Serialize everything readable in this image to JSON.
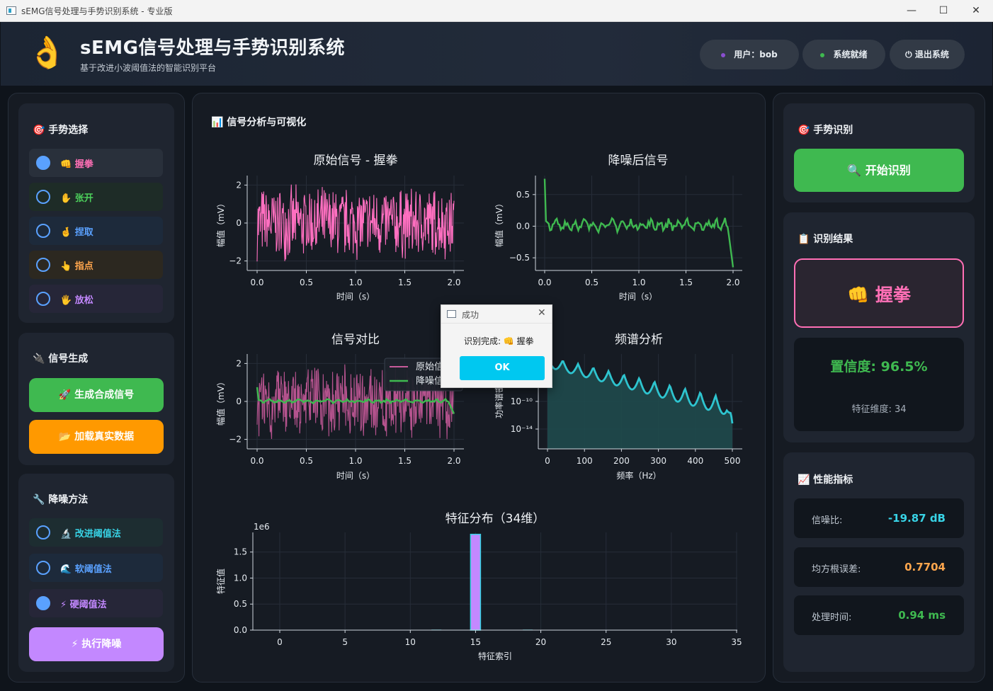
{
  "window": {
    "title": "sEMG信号处理与手势识别系统 - 专业版",
    "minimize": "—",
    "maximize": "☐",
    "close": "✕"
  },
  "header": {
    "logo": "👌",
    "title": "sEMG信号处理与手势识别系统",
    "subtitle": "基于改进小波阈值法的智能识别平台",
    "user": "用户：bob",
    "status": "系统就绪",
    "logout": "⏻ 退出系统"
  },
  "gesture_select": {
    "title": "🎯 手势选择",
    "options": [
      {
        "label": "👊 握拳",
        "selected": true,
        "color": "#ff6fb5"
      },
      {
        "label": "✋ 张开",
        "selected": false,
        "color": "#4ccf5b"
      },
      {
        "label": "🤞 捏取",
        "selected": false,
        "color": "#5aa1ff"
      },
      {
        "label": "👆 指点",
        "selected": false,
        "color": "#ffa64d"
      },
      {
        "label": "🖐 放松",
        "selected": false,
        "color": "#c388ff"
      }
    ]
  },
  "signal_gen": {
    "title": "🔌 信号生成",
    "generate": "🚀 生成合成信号",
    "load": "📂 加载真实数据"
  },
  "denoise": {
    "title": "🔧 降噪方法",
    "options": [
      {
        "label": "🔬 改进阈值法",
        "selected": false,
        "color": "#38d3e6"
      },
      {
        "label": "🌊 软阈值法",
        "selected": false,
        "color": "#5aa1ff"
      },
      {
        "label": "⚡ 硬阈值法",
        "selected": true,
        "color": "#c388ff"
      }
    ],
    "run": "⚡ 执行降噪"
  },
  "analysis": {
    "title": "📊 信号分析与可视化"
  },
  "chart_data": [
    {
      "type": "line",
      "title": "原始信号 - 握拳",
      "xlabel": "时间（s）",
      "ylabel": "幅值（mV）",
      "xlim": [
        0,
        2
      ],
      "ylim": [
        -2.5,
        2.5
      ],
      "xticks": [
        "0.0",
        "0.5",
        "1.0",
        "1.5",
        "2.0"
      ],
      "yticks": [
        "2",
        "0",
        "−2"
      ],
      "series": [
        {
          "color": "#ff6fc0",
          "amplitude": 2.1
        }
      ]
    },
    {
      "type": "line",
      "title": "降噪后信号",
      "xlabel": "时间（s）",
      "ylabel": "幅值（mV）",
      "xlim": [
        0,
        2
      ],
      "ylim": [
        -0.7,
        0.8
      ],
      "xticks": [
        "0.0",
        "0.5",
        "1.0",
        "1.5",
        "2.0"
      ],
      "yticks": [
        "0.5",
        "0.0",
        "−0.5"
      ],
      "series": [
        {
          "color": "#3fb950",
          "start": 0.75,
          "baseline": 0.0,
          "end": -0.65
        }
      ]
    },
    {
      "type": "line",
      "title": "信号对比",
      "xlabel": "时间（s）",
      "ylabel": "幅值（mV）",
      "xlim": [
        0,
        2
      ],
      "ylim": [
        -2.5,
        2.5
      ],
      "xticks": [
        "0.0",
        "0.5",
        "1.0",
        "1.5",
        "2.0"
      ],
      "yticks": [
        "2",
        "0",
        "−2"
      ],
      "legend": [
        "原始信",
        "降噪信"
      ],
      "series": [
        {
          "name": "原始信",
          "color": "#c65a9a"
        },
        {
          "name": "降噪信",
          "color": "#3fb950"
        }
      ]
    },
    {
      "type": "area",
      "title": "频谱分析",
      "xlabel": "频率（Hz）",
      "ylabel": "功率谱密",
      "xlim": [
        0,
        500
      ],
      "xticks": [
        "0",
        "100",
        "200",
        "300",
        "400",
        "500"
      ],
      "yticks": [
        "10⁻¹⁰",
        "10⁻¹⁴"
      ],
      "series": [
        {
          "color": "#2ec4cf"
        }
      ]
    },
    {
      "type": "bar",
      "title": "特征分布（34维）",
      "xlabel": "特征索引",
      "ylabel": "特征值",
      "scale_label": "1e6",
      "xlim": [
        -3,
        35
      ],
      "ylim": [
        0,
        1.85
      ],
      "xticks": [
        "0",
        "5",
        "10",
        "15",
        "20",
        "25",
        "30",
        "35"
      ],
      "yticks": [
        "1.5",
        "1.0",
        "0.5",
        "0.0"
      ],
      "values": [
        {
          "x": 15,
          "y": 1.84
        },
        {
          "x": 12,
          "y": 0.01
        },
        {
          "x": 19,
          "y": 0.01
        }
      ]
    }
  ],
  "recognition": {
    "title": "🎯 手势识别",
    "start": "🔍 开始识别",
    "result_title": "📋 识别结果",
    "result": "👊 握拳",
    "confidence": "置信度: 96.5%",
    "feature_dim": "特征维度: 34"
  },
  "performance": {
    "title": "📈 性能指标",
    "metrics": [
      {
        "label": "信噪比:",
        "value": "-19.87 dB",
        "color": "#38d3e6"
      },
      {
        "label": "均方根误差:",
        "value": "0.7704",
        "color": "#ffa64d"
      },
      {
        "label": "处理时间:",
        "value": "0.94 ms",
        "color": "#3fb950"
      }
    ]
  },
  "dialog": {
    "title": "成功",
    "message": "识别完成: 👊 握拳",
    "ok": "OK"
  },
  "colors": {
    "green": "#3fb950",
    "orange": "#ff9900",
    "purple": "#c388ff",
    "pink": "#ff6fb5",
    "cyan": "#00c8f0"
  }
}
